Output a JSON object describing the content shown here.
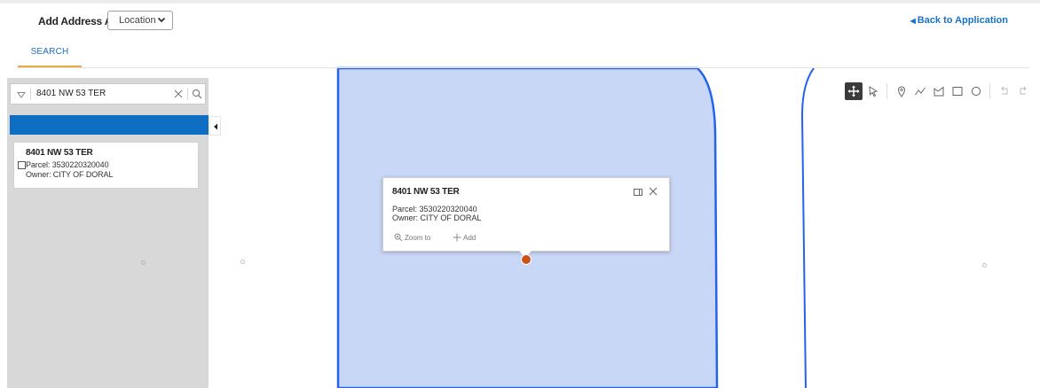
{
  "header": {
    "add_address_label": "Add Address As",
    "address_type_selected": "Location",
    "back_link": "Back to Application"
  },
  "tabs": [
    "SEARCH"
  ],
  "search": {
    "value": "8401 NW 53 TER"
  },
  "results": [
    {
      "title": "8401 NW 53 TER",
      "parcel": "Parcel: 3530220320040",
      "owner": "Owner: CITY OF DORAL"
    }
  ],
  "popup": {
    "title": "8401 NW 53 TER",
    "parcel": "Parcel: 3530220320040",
    "owner": "Owner: CITY OF DORAL",
    "zoom_label": "Zoom to",
    "add_label": "Add"
  },
  "toolbar_tools": [
    "pan-icon",
    "select-arrow-icon",
    "point-icon",
    "polyline-icon",
    "polygon-icon",
    "rectangle-icon",
    "circle-icon",
    "undo-icon",
    "redo-icon"
  ],
  "colors": {
    "accent_blue": "#0e6fc2",
    "tab_underline": "#e3ad3a",
    "parcel_fill": "#c9d7f6",
    "parcel_outline": "#2563eb",
    "marker": "#c9541b"
  }
}
